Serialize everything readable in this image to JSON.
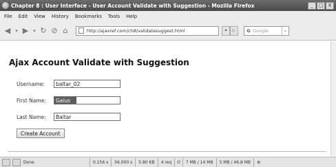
{
  "window": {
    "title": "Chapter 8 : User Interface - User Account Validate with Suggestion - Mozilla Firefox",
    "controls": [
      "_",
      "□",
      "X"
    ]
  },
  "menu": [
    "File",
    "Edit",
    "View",
    "History",
    "Bookmarks",
    "Tools",
    "Help"
  ],
  "toolbar": {
    "url": "http://ajaxref.com/ch8/validatesuggest.html",
    "search_placeholder": "Google"
  },
  "page": {
    "heading": "Ajax Account Validate with Suggestion",
    "fields": [
      {
        "label": "Username:",
        "value": "baltar_02"
      },
      {
        "label": "First Name:",
        "value": "Gaius"
      },
      {
        "label": "Last Name:",
        "value": "Baltar"
      }
    ],
    "submit_label": "Create Account"
  },
  "status": {
    "text": "Done",
    "cells": [
      "0.156 s",
      "56.000 s",
      "5.80 KB",
      "4 req",
      "O",
      "7 MB / 14 MB",
      "5 MB / 46.8 MB"
    ]
  }
}
